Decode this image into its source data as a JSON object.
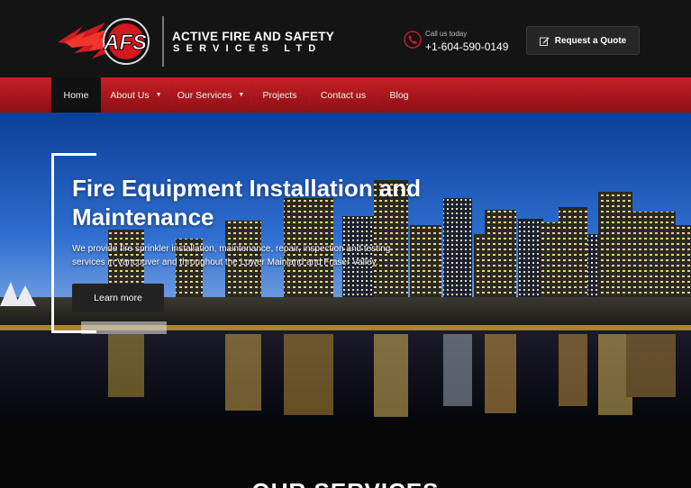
{
  "header": {
    "logo_text": "AFS",
    "company_name_line1": "ACTIVE FIRE AND SAFETY",
    "company_name_line2": "SERVICES LTD",
    "call_label": "Call us today",
    "phone": "+1-604-590-0149",
    "quote_button": "Request a Quote"
  },
  "nav": {
    "items": [
      {
        "label": "Home",
        "active": true
      },
      {
        "label": "About Us",
        "dropdown": true
      },
      {
        "label": "Our Services",
        "dropdown": true
      },
      {
        "label": "Projects"
      },
      {
        "label": "Contact us"
      },
      {
        "label": "Blog"
      }
    ]
  },
  "hero": {
    "title": "Fire Equipment Installation and Maintenance",
    "description": "We provide fire sprinkler installation, maintenance, repair, inspection and testing services in Vancouver and throughout the Lower Mainland and Fraser Valley.",
    "button": "Learn more"
  },
  "services": {
    "heading": "OUR SERVICES"
  },
  "colors": {
    "brand_red": "#c81f25",
    "header_bg": "#141414",
    "button_dark": "#222222"
  },
  "icons": {
    "phone": "phone-icon",
    "quote": "edit-icon",
    "caret": "chevron-down-icon"
  }
}
